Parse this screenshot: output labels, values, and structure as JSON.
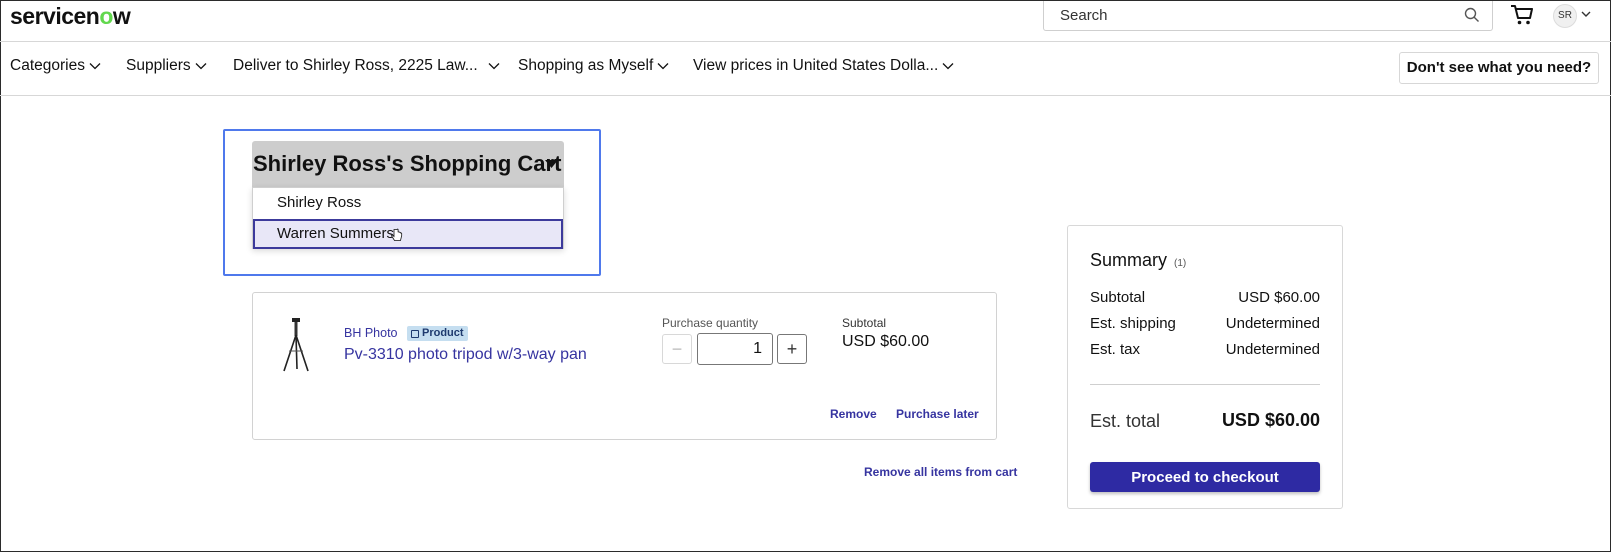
{
  "header": {
    "logo_text_pre": "servicen",
    "logo_text_o": "o",
    "logo_text_post": "w",
    "search_placeholder": "Search",
    "avatar_initials": "SR"
  },
  "nav": {
    "items": [
      {
        "label": "Categories"
      },
      {
        "label": "Suppliers"
      },
      {
        "label": "Deliver to Shirley Ross, 2225 Law..."
      },
      {
        "label": "Shopping as Myself"
      },
      {
        "label": "View prices in United States Dolla..."
      }
    ],
    "help_button": "Don't see what you need?"
  },
  "cart_selector": {
    "title": "Shirley Ross's Shopping Cart",
    "options": [
      "Shirley Ross",
      "Warren Summers"
    ],
    "highlighted": "Warren Summers"
  },
  "cart_item": {
    "supplier": "BH Photo",
    "badge": "Product",
    "name": "Pv-3310 photo tripod w/3-way pan",
    "quantity_label": "Purchase quantity",
    "quantity": "1",
    "subtotal_label": "Subtotal",
    "subtotal": "USD $60.00",
    "remove_label": "Remove",
    "purchase_later_label": "Purchase later"
  },
  "remove_all_label": "Remove all items from cart",
  "summary": {
    "title": "Summary",
    "count": "(1)",
    "rows": [
      {
        "label": "Subtotal",
        "value": "USD $60.00"
      },
      {
        "label": "Est. shipping",
        "value": "Undetermined"
      },
      {
        "label": "Est. tax",
        "value": "Undetermined"
      }
    ],
    "total_label": "Est. total",
    "total_value": "USD $60.00",
    "checkout_label": "Proceed to checkout"
  },
  "colors": {
    "accent": "#2e2aa3",
    "link": "#3634a0",
    "highlight_border": "#4f79ec",
    "logo_o": "#62d84e"
  }
}
